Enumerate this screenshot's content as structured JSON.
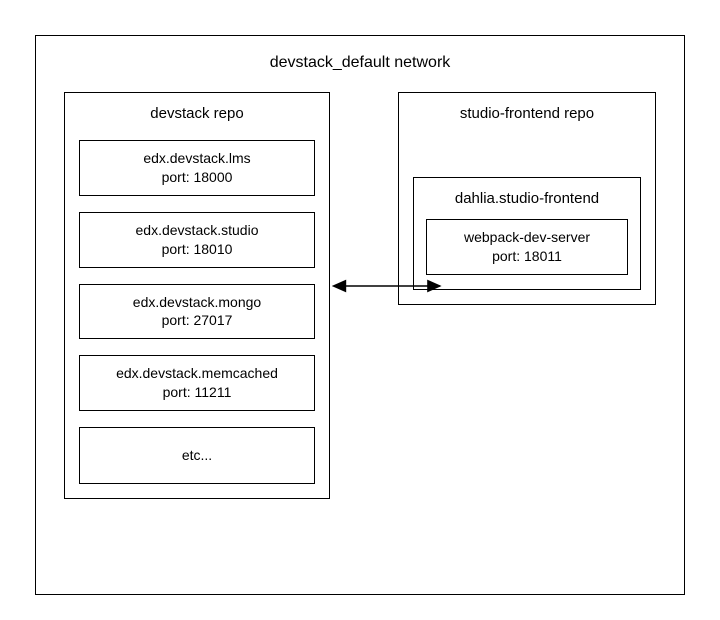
{
  "network": {
    "title": "devstack_default network"
  },
  "left": {
    "title": "devstack repo",
    "services": [
      {
        "name": "edx.devstack.lms",
        "port_label": "port: 18000"
      },
      {
        "name": "edx.devstack.studio",
        "port_label": "port: 18010"
      },
      {
        "name": "edx.devstack.mongo",
        "port_label": "port: 27017"
      },
      {
        "name": "edx.devstack.memcached",
        "port_label": "port: 11211"
      }
    ],
    "etc": "etc..."
  },
  "right": {
    "title": "studio-frontend repo",
    "container": {
      "title": "dahlia.studio-frontend",
      "service": {
        "name": "webpack-dev-server",
        "port_label": "port: 18011"
      }
    }
  },
  "chart_data": {
    "type": "diagram",
    "title": "devstack_default network",
    "nodes": [
      {
        "id": "devstack-repo",
        "label": "devstack repo",
        "children": [
          {
            "id": "lms",
            "label": "edx.devstack.lms",
            "port": 18000
          },
          {
            "id": "studio",
            "label": "edx.devstack.studio",
            "port": 18010
          },
          {
            "id": "mongo",
            "label": "edx.devstack.mongo",
            "port": 27017
          },
          {
            "id": "memcached",
            "label": "edx.devstack.memcached",
            "port": 11211
          },
          {
            "id": "etc",
            "label": "etc..."
          }
        ]
      },
      {
        "id": "studio-frontend-repo",
        "label": "studio-frontend repo",
        "children": [
          {
            "id": "dahlia",
            "label": "dahlia.studio-frontend",
            "children": [
              {
                "id": "webpack",
                "label": "webpack-dev-server",
                "port": 18011
              }
            ]
          }
        ]
      }
    ],
    "edges": [
      {
        "from": "studio",
        "to": "dahlia",
        "direction": "bidirectional"
      }
    ]
  }
}
